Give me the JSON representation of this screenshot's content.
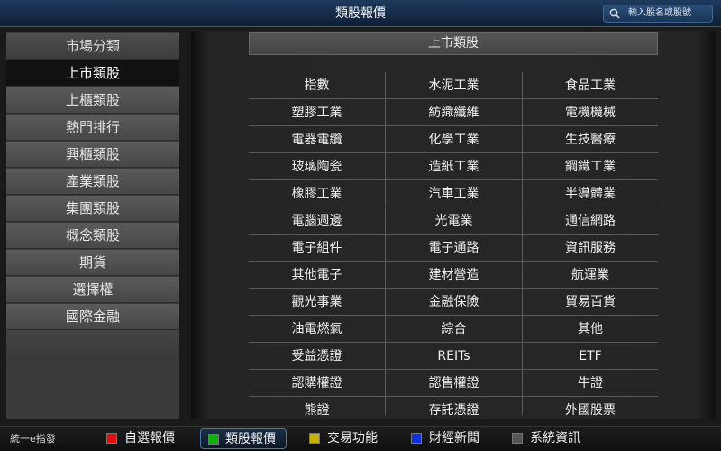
{
  "header": {
    "title": "類股報價",
    "search_placeholder": "輸入股名或股號"
  },
  "sidebar": {
    "items": [
      {
        "label": "市場分類"
      },
      {
        "label": "上市類股"
      },
      {
        "label": "上櫃類股"
      },
      {
        "label": "熱門排行"
      },
      {
        "label": "興櫃類股"
      },
      {
        "label": "產業類股"
      },
      {
        "label": "集團類股"
      },
      {
        "label": "概念類股"
      },
      {
        "label": "期貨"
      },
      {
        "label": "選擇權"
      },
      {
        "label": "國際金融"
      }
    ],
    "selected_index": 1
  },
  "main": {
    "title": "上市類股",
    "rows": [
      [
        "指數",
        "水泥工業",
        "食品工業"
      ],
      [
        "塑膠工業",
        "紡織纖維",
        "電機機械"
      ],
      [
        "電器電纜",
        "化學工業",
        "生技醫療"
      ],
      [
        "玻璃陶瓷",
        "造紙工業",
        "鋼鐵工業"
      ],
      [
        "橡膠工業",
        "汽車工業",
        "半導體業"
      ],
      [
        "電腦週邊",
        "光電業",
        "通信網路"
      ],
      [
        "電子組件",
        "電子通路",
        "資訊服務"
      ],
      [
        "其他電子",
        "建材營造",
        "航運業"
      ],
      [
        "觀光事業",
        "金融保險",
        "貿易百貨"
      ],
      [
        "油電燃氣",
        "綜合",
        "其他"
      ],
      [
        "受益憑證",
        "REITs",
        "ETF"
      ],
      [
        "認購權證",
        "認售權證",
        "牛證"
      ],
      [
        "熊證",
        "存託憑證",
        "外國股票"
      ]
    ]
  },
  "bottombar": {
    "app_name": "統一e指發",
    "tabs": [
      {
        "label": "自選報價",
        "color": "#e01010"
      },
      {
        "label": "類股報價",
        "color": "#10b010"
      },
      {
        "label": "交易功能",
        "color": "#c8b400"
      },
      {
        "label": "財經新聞",
        "color": "#1030e0"
      },
      {
        "label": "系統資訊",
        "color": "#555555"
      }
    ],
    "active_index": 1
  }
}
